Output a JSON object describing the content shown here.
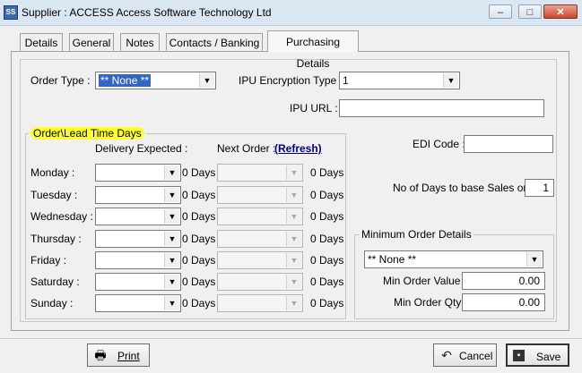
{
  "window": {
    "title": "Supplier : ACCESS Access Software Technology Ltd",
    "minimize": "–",
    "maximize": "□",
    "close": "✕"
  },
  "tabs": [
    "Details",
    "General",
    "Notes",
    "Contacts / Banking",
    "Purchasing Details"
  ],
  "active_tab": "Purchasing Details",
  "order_type": {
    "label": "Order Type :",
    "value": "** None **"
  },
  "ipu_encryption": {
    "label": "IPU Encryption Type :",
    "value": "1"
  },
  "ipu_url": {
    "label": "IPU URL :",
    "value": ""
  },
  "lead_time": {
    "legend": "Order\\Lead Time Days",
    "col_delivery": "Delivery Expected :",
    "col_next": "Next Order :",
    "refresh": "(Refresh)",
    "days": [
      {
        "label": "Monday :",
        "delivery_days": "0 Days",
        "next_days": "0 Days"
      },
      {
        "label": "Tuesday :",
        "delivery_days": "0 Days",
        "next_days": "0 Days"
      },
      {
        "label": "Wednesday :",
        "delivery_days": "0 Days",
        "next_days": "0 Days"
      },
      {
        "label": "Thursday :",
        "delivery_days": "0 Days",
        "next_days": "0 Days"
      },
      {
        "label": "Friday :",
        "delivery_days": "0 Days",
        "next_days": "0 Days"
      },
      {
        "label": "Saturday :",
        "delivery_days": "0 Days",
        "next_days": "0 Days"
      },
      {
        "label": "Sunday :",
        "delivery_days": "0 Days",
        "next_days": "0 Days"
      }
    ]
  },
  "edi_code": {
    "label": "EDI Code :",
    "value": ""
  },
  "days_sales": {
    "label": "No of Days to base Sales on :",
    "value": "1"
  },
  "min_order": {
    "legend": "Minimum Order Details",
    "type_value": "** None **",
    "value_label": "Min Order Value :",
    "value": "0.00",
    "qty_label": "Min Order Qty :",
    "qty": "0.00"
  },
  "buttons": {
    "print": "Print",
    "cancel": "Cancel",
    "save": "Save"
  },
  "icons": [
    "app-icon",
    "printer-icon",
    "undo-icon",
    "floppy-disk-icon",
    "chevron-down-icon"
  ]
}
